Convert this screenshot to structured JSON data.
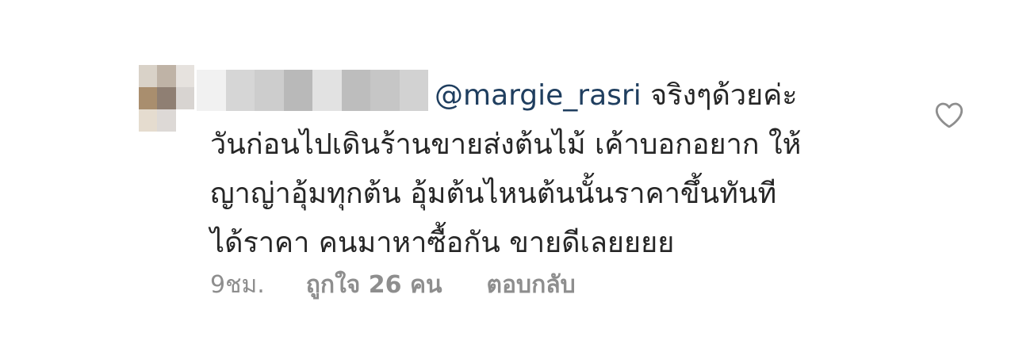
{
  "comment": {
    "mention": "@margie_rasri",
    "lines": [
      " จริงๆด้วยค่ะ",
      "วันก่อนไปเดินร้านขายส่งต้นไม้ เค้าบอกอยาก ให้",
      "ญาญ่าอุ้มทุกต้น อุ้มต้นไหนต้นนั้นราคาขึ้นทันที",
      "ได้ราคา คนมาหาซื้อกัน ขายดีเลยยยย"
    ],
    "time": "9ชม.",
    "likes": "ถูกใจ 26 คน",
    "reply": "ตอบกลับ"
  },
  "icons": {
    "like": "heart-outline-icon"
  },
  "colors": {
    "mention": "#1f3e5f",
    "meta": "#8e8e8e",
    "text": "#262626"
  }
}
